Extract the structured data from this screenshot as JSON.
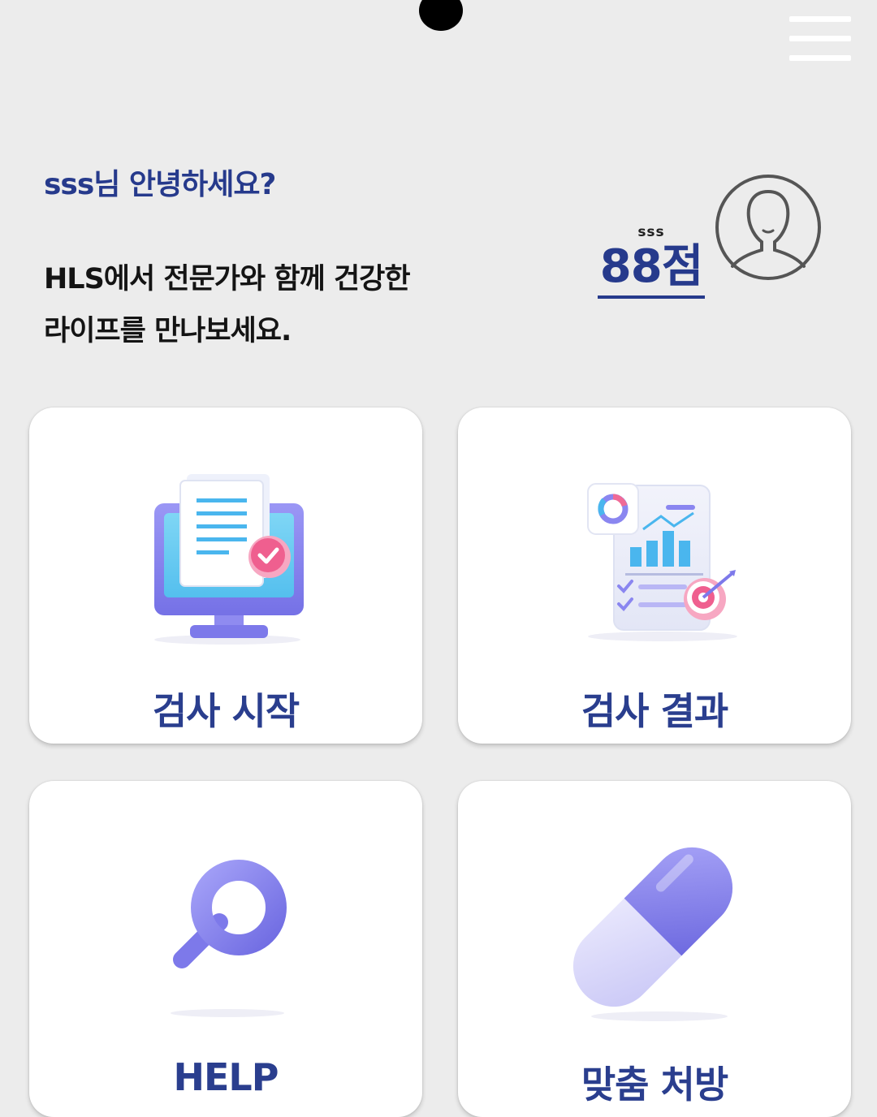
{
  "header": {
    "camera_icon": "camera-cutout",
    "menu_icon": "hamburger-menu-icon"
  },
  "greeting": {
    "text": "sss님 안녕하세요?",
    "intro_line1": "HLS에서 전문가와 함께 건강한",
    "intro_line2": "라이프를 만나보세요."
  },
  "profile": {
    "name": "sss",
    "score": "88점",
    "avatar_icon": "user-avatar-icon"
  },
  "menu": {
    "cards": [
      {
        "label": "검사 시작",
        "icon": "monitor-document-check-icon"
      },
      {
        "label": "검사 결과",
        "icon": "report-chart-target-icon"
      },
      {
        "label": "HELP",
        "icon": "magnifier-icon"
      },
      {
        "label": "맞춤 처방",
        "icon": "pill-capsule-icon"
      }
    ]
  },
  "colors": {
    "background": "#ececec",
    "accent": "#263a8c",
    "card": "#ffffff",
    "illustration_purple": "#8a86f0"
  }
}
